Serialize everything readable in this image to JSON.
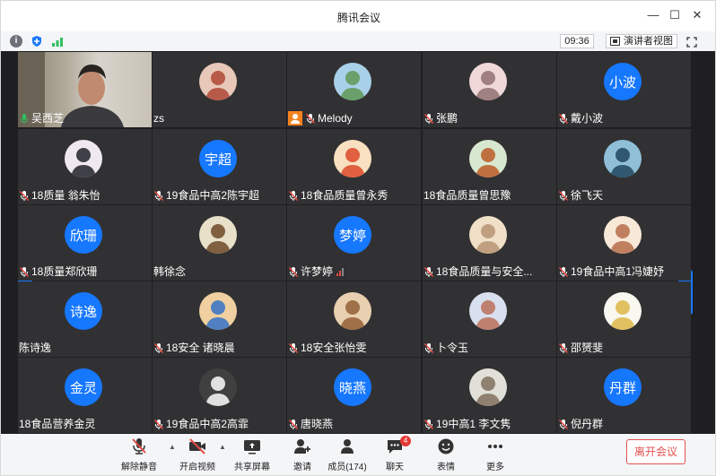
{
  "window": {
    "title": "腾讯会议"
  },
  "toolbar": {
    "time": "09:36",
    "speaker_view": "演讲者视图"
  },
  "participants": [
    {
      "name": "吴西芝",
      "mic": "on",
      "avatar": "video"
    },
    {
      "name": "zs",
      "mic": "none",
      "avatar": "photo"
    },
    {
      "name": "Melody",
      "mic": "muted",
      "host": true,
      "avatar": "photo"
    },
    {
      "name": "张鹏",
      "mic": "muted",
      "avatar": "photo"
    },
    {
      "name": "戴小波",
      "mic": "muted",
      "avatar": "text",
      "avatar_text": "小波"
    },
    {
      "name": "18质量 翁朱怡",
      "mic": "muted",
      "avatar": "photo"
    },
    {
      "name": "19食品中高2陈宇超",
      "mic": "muted",
      "avatar": "text",
      "avatar_text": "宇超"
    },
    {
      "name": "18食品质量曾永秀",
      "mic": "muted",
      "avatar": "photo"
    },
    {
      "name": "18食品质量曾思豫",
      "mic": "none",
      "avatar": "photo"
    },
    {
      "name": "徐飞天",
      "mic": "muted",
      "avatar": "photo"
    },
    {
      "name": "18质量郑欣珊",
      "mic": "muted",
      "avatar": "text",
      "avatar_text": "欣珊"
    },
    {
      "name": "韩徐念",
      "mic": "none",
      "avatar": "photo"
    },
    {
      "name": "许梦婷",
      "mic": "muted",
      "avatar": "text",
      "avatar_text": "梦婷",
      "signal_weak": true
    },
    {
      "name": "18食品质量与安全...",
      "mic": "muted",
      "avatar": "photo"
    },
    {
      "name": "19食品中高1冯婕妤",
      "mic": "muted",
      "avatar": "photo"
    },
    {
      "name": "陈诗逸",
      "mic": "none",
      "avatar": "text",
      "avatar_text": "诗逸"
    },
    {
      "name": "18安全 诸晓晨",
      "mic": "muted",
      "avatar": "photo"
    },
    {
      "name": "18安全张怡雯",
      "mic": "muted",
      "avatar": "photo"
    },
    {
      "name": "卜令玉",
      "mic": "muted",
      "avatar": "photo"
    },
    {
      "name": "邵赟斐",
      "mic": "muted",
      "avatar": "photo"
    },
    {
      "name": "18食品营养金灵",
      "mic": "none",
      "avatar": "text",
      "avatar_text": "金灵"
    },
    {
      "name": "19食品中高2高霏",
      "mic": "muted",
      "avatar": "photo"
    },
    {
      "name": "唐晓燕",
      "mic": "muted",
      "avatar": "text",
      "avatar_text": "晓燕"
    },
    {
      "name": "19中高1 李文隽",
      "mic": "muted",
      "avatar": "photo"
    },
    {
      "name": "倪丹群",
      "mic": "muted",
      "avatar": "text",
      "avatar_text": "丹群"
    }
  ],
  "controls": {
    "unmute": "解除静音",
    "start_video": "开启视频",
    "share_screen": "共享屏幕",
    "invite": "邀请",
    "members": "成员(174)",
    "chat": "聊天",
    "chat_badge": "4",
    "reactions": "表情",
    "more": "更多",
    "leave": "离开会议"
  },
  "colors": {
    "accent": "#1677ff",
    "tile_bg": "#313133",
    "grid_bg": "#1f1f21",
    "muted_red": "#e14b43",
    "leave_red": "#e35050",
    "speaking_green": "#2fbf5f"
  }
}
